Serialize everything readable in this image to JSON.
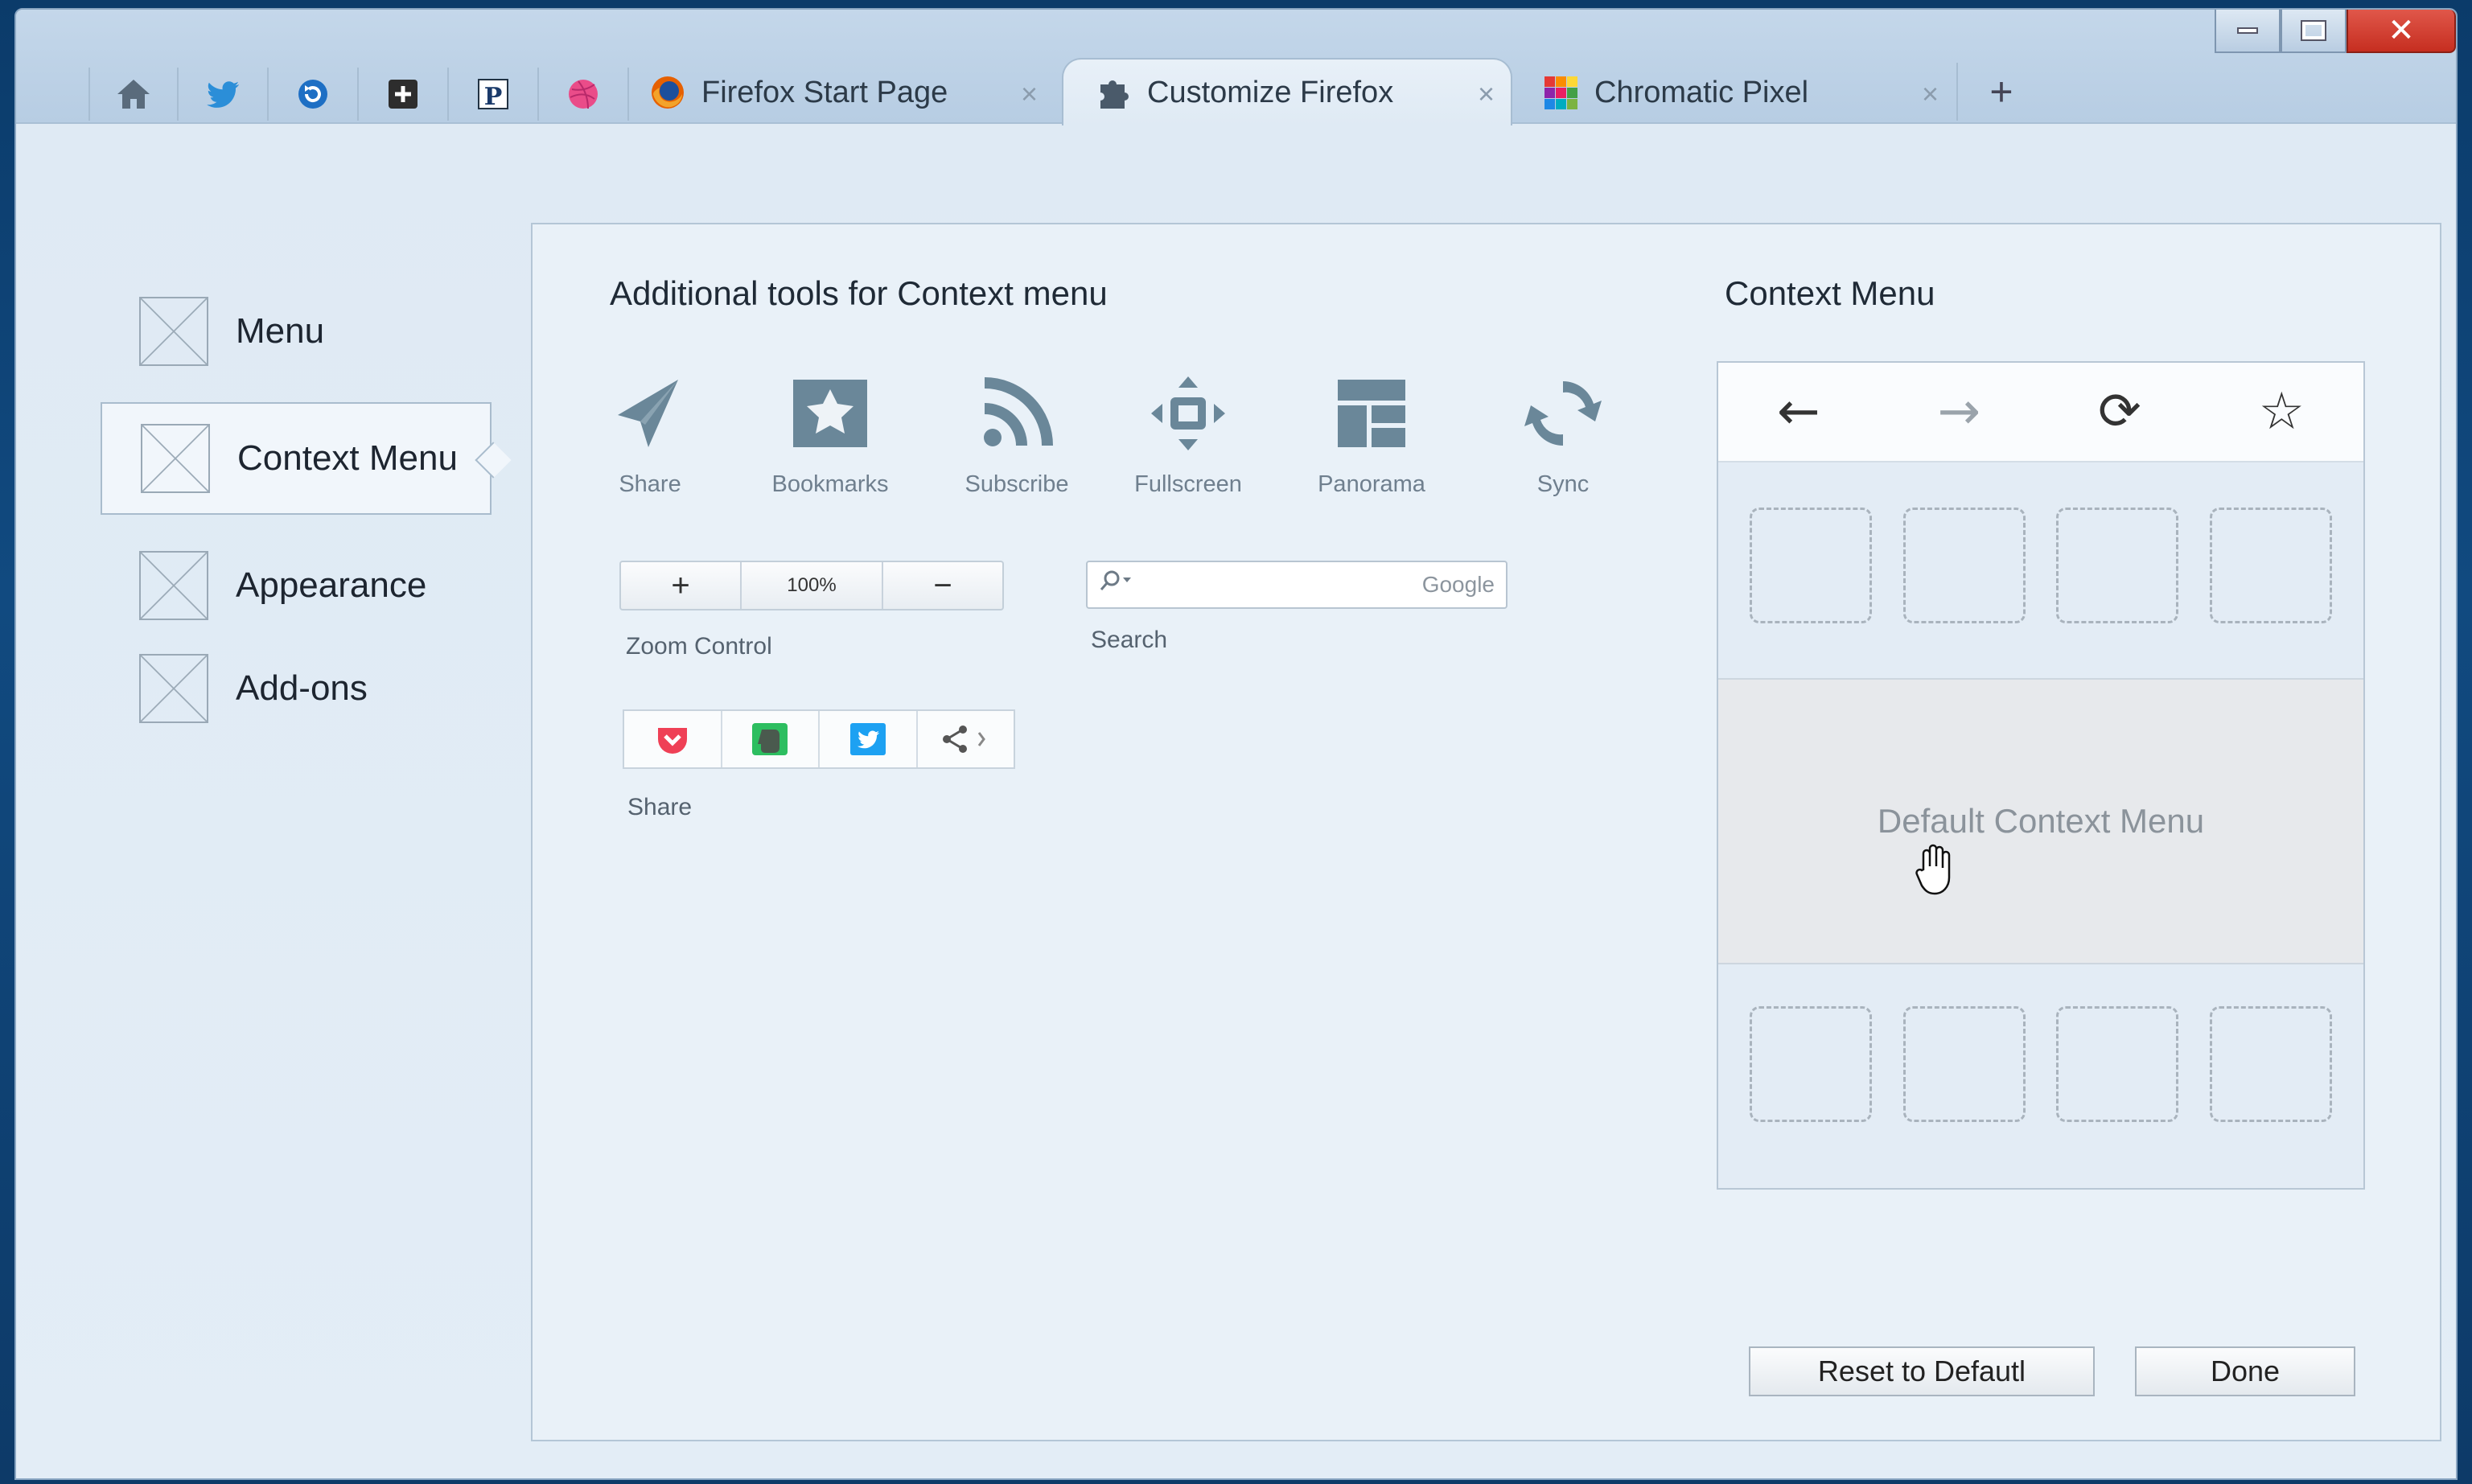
{
  "window": {
    "controls": {
      "minimize": "minimize",
      "maximize": "maximize",
      "close": "✕"
    }
  },
  "app_icons": [
    {
      "name": "home-icon"
    },
    {
      "name": "twitter-icon"
    },
    {
      "name": "refresh-app-icon"
    },
    {
      "name": "addon-app-icon"
    },
    {
      "name": "p-app-icon"
    },
    {
      "name": "dribbble-icon"
    }
  ],
  "tabs": [
    {
      "label": "Firefox Start Page",
      "close": "×"
    },
    {
      "label": "Customize Firefox",
      "close": "×"
    },
    {
      "label": "Chromatic Pixel",
      "close": "×"
    }
  ],
  "new_tab": "+",
  "nav": {
    "items": [
      {
        "label": "Menu"
      },
      {
        "label": "Context Menu"
      },
      {
        "label": "Appearance"
      },
      {
        "label": "Add-ons"
      }
    ]
  },
  "panel": {
    "title": "Additional tools for Context menu",
    "context_title": "Context Menu"
  },
  "tools": [
    {
      "label": "Share",
      "icon": "share-plane-icon"
    },
    {
      "label": "Bookmarks",
      "icon": "bookmarks-icon"
    },
    {
      "label": "Subscribe",
      "icon": "rss-icon"
    },
    {
      "label": "Fullscreen",
      "icon": "fullscreen-icon"
    },
    {
      "label": "Panorama",
      "icon": "panorama-icon"
    },
    {
      "label": "Sync",
      "icon": "sync-icon"
    }
  ],
  "zoom": {
    "plus": "+",
    "value": "100%",
    "minus": "−",
    "label": "Zoom Control"
  },
  "search": {
    "engine": "Google",
    "label": "Search"
  },
  "share": {
    "label": "Share",
    "services": [
      "pocket-icon",
      "evernote-icon",
      "twitter-icon",
      "share-more-icon"
    ]
  },
  "context_menu": {
    "nav": [
      "←",
      "→",
      "⟳",
      "☆"
    ],
    "default_label": "Default Context Menu"
  },
  "buttons": {
    "reset": "Reset to Defautl",
    "done": "Done"
  },
  "colors": {
    "accent": "#1e6fc4",
    "tool_icon": "#6a8799",
    "close_red": "#d03a2c"
  }
}
